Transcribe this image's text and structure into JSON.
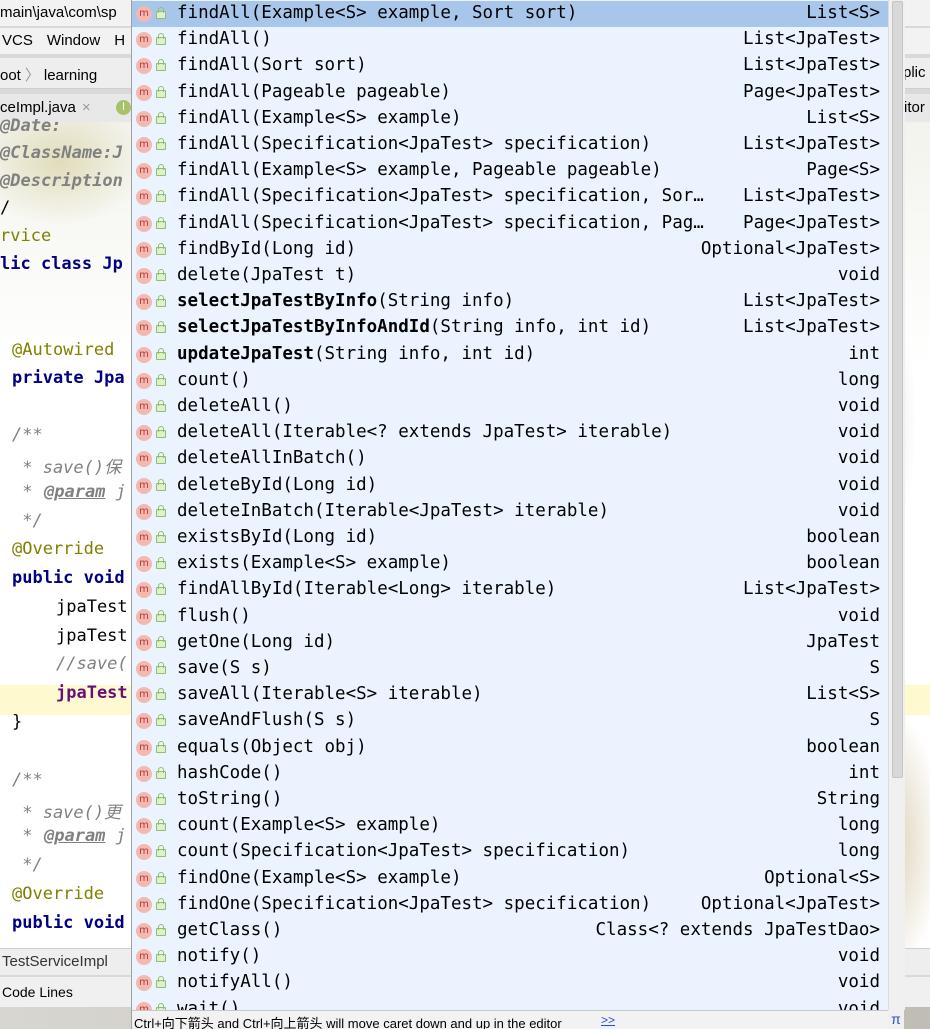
{
  "ide": {
    "path_fragment": "main\\java\\com\\sp",
    "menu": [
      "VCS",
      "Window",
      "H"
    ],
    "breadcrumbs": [
      "oot",
      "learning"
    ],
    "breadcrumb_right": "plic",
    "tab_label": "ceImpl.java",
    "tab_close": "×",
    "tab_badge": "I",
    "tab_right": "itor",
    "code_lines": [
      {
        "text": "@Date:",
        "style": "ann-doc"
      },
      {
        "text": "@ClassName:J",
        "style": "ann-doc"
      },
      {
        "text": "@Description",
        "style": "ann-doc"
      },
      {
        "text": "/",
        "style": "plain"
      },
      {
        "text": "rvice",
        "style": "ann"
      },
      {
        "text": "lic class Jp",
        "style": "kw"
      },
      {
        "text": "@Autowired",
        "style": "ann"
      },
      {
        "text": "private Jpa",
        "style": "kw"
      },
      {
        "text": "/**",
        "style": "cmt"
      },
      {
        "text": " * save()保",
        "style": "cmt"
      },
      {
        "text": "@param",
        "style": "doctag"
      },
      {
        "text": " */",
        "style": "cmt"
      },
      {
        "text": "@Override",
        "style": "ann"
      },
      {
        "text": "public void",
        "style": "kw"
      },
      {
        "text": "jpaTest",
        "style": "plain"
      },
      {
        "text": "jpaTest",
        "style": "plain"
      },
      {
        "text": "//save(",
        "style": "cmt"
      },
      {
        "text": "jpaTest",
        "style": "field"
      },
      {
        "text": "}",
        "style": "plain"
      },
      {
        "text": "/**",
        "style": "cmt"
      },
      {
        "text": " * save()更",
        "style": "cmt"
      },
      {
        "text": "@param",
        "style": "doctag"
      },
      {
        "text": " */",
        "style": "cmt"
      },
      {
        "text": "@Override",
        "style": "ann"
      },
      {
        "text": "public void",
        "style": "kw"
      }
    ],
    "doc_param_suffix": "j",
    "status_text": "TestServiceImpl",
    "bottom_text": "Code Lines"
  },
  "completion": {
    "items": [
      {
        "name": "findAll",
        "params": "(Example<S> example, Sort sort)",
        "type": "List<S>",
        "bold": false,
        "selected": true
      },
      {
        "name": "findAll",
        "params": "()",
        "type": "List<JpaTest>",
        "bold": false
      },
      {
        "name": "findAll",
        "params": "(Sort sort)",
        "type": "List<JpaTest>",
        "bold": false
      },
      {
        "name": "findAll",
        "params": "(Pageable pageable)",
        "type": "Page<JpaTest>",
        "bold": false
      },
      {
        "name": "findAll",
        "params": "(Example<S> example)",
        "type": "List<S>",
        "bold": false
      },
      {
        "name": "findAll",
        "params": "(Specification<JpaTest> specification)",
        "type": "List<JpaTest>",
        "bold": false
      },
      {
        "name": "findAll",
        "params": "(Example<S> example, Pageable pageable)",
        "type": "Page<S>",
        "bold": false
      },
      {
        "name": "findAll",
        "params": "(Specification<JpaTest> specification, Sor…",
        "type": "List<JpaTest>",
        "bold": false
      },
      {
        "name": "findAll",
        "params": "(Specification<JpaTest> specification, Pag…",
        "type": "Page<JpaTest>",
        "bold": false
      },
      {
        "name": "findById",
        "params": "(Long id)",
        "type": "Optional<JpaTest>",
        "bold": false
      },
      {
        "name": "delete",
        "params": "(JpaTest t)",
        "type": "void",
        "bold": false
      },
      {
        "name": "selectJpaTestByInfo",
        "params": "(String info)",
        "type": "List<JpaTest>",
        "bold": true
      },
      {
        "name": "selectJpaTestByInfoAndId",
        "params": "(String info, int id)",
        "type": "List<JpaTest>",
        "bold": true
      },
      {
        "name": "updateJpaTest",
        "params": "(String info, int id)",
        "type": "int",
        "bold": true
      },
      {
        "name": "count",
        "params": "()",
        "type": "long",
        "bold": false
      },
      {
        "name": "deleteAll",
        "params": "()",
        "type": "void",
        "bold": false
      },
      {
        "name": "deleteAll",
        "params": "(Iterable<? extends JpaTest> iterable)",
        "type": "void",
        "bold": false
      },
      {
        "name": "deleteAllInBatch",
        "params": "()",
        "type": "void",
        "bold": false
      },
      {
        "name": "deleteById",
        "params": "(Long id)",
        "type": "void",
        "bold": false
      },
      {
        "name": "deleteInBatch",
        "params": "(Iterable<JpaTest> iterable)",
        "type": "void",
        "bold": false
      },
      {
        "name": "existsById",
        "params": "(Long id)",
        "type": "boolean",
        "bold": false
      },
      {
        "name": "exists",
        "params": "(Example<S> example)",
        "type": "boolean",
        "bold": false
      },
      {
        "name": "findAllById",
        "params": "(Iterable<Long> iterable)",
        "type": "List<JpaTest>",
        "bold": false
      },
      {
        "name": "flush",
        "params": "()",
        "type": "void",
        "bold": false
      },
      {
        "name": "getOne",
        "params": "(Long id)",
        "type": "JpaTest",
        "bold": false
      },
      {
        "name": "save",
        "params": "(S s)",
        "type": "S",
        "bold": false
      },
      {
        "name": "saveAll",
        "params": "(Iterable<S> iterable)",
        "type": "List<S>",
        "bold": false
      },
      {
        "name": "saveAndFlush",
        "params": "(S s)",
        "type": "S",
        "bold": false
      },
      {
        "name": "equals",
        "params": "(Object obj)",
        "type": "boolean",
        "bold": false
      },
      {
        "name": "hashCode",
        "params": "()",
        "type": "int",
        "bold": false
      },
      {
        "name": "toString",
        "params": "()",
        "type": "String",
        "bold": false
      },
      {
        "name": "count",
        "params": "(Example<S> example)",
        "type": "long",
        "bold": false
      },
      {
        "name": "count",
        "params": "(Specification<JpaTest> specification)",
        "type": "long",
        "bold": false
      },
      {
        "name": "findOne",
        "params": "(Example<S> example)",
        "type": "Optional<S>",
        "bold": false
      },
      {
        "name": "findOne",
        "params": "(Specification<JpaTest> specification)",
        "type": "Optional<JpaTest>",
        "bold": false
      },
      {
        "name": "getClass",
        "params": "()",
        "type": "Class<? extends JpaTestDao>",
        "bold": false
      },
      {
        "name": "notify",
        "params": "()",
        "type": "void",
        "bold": false
      },
      {
        "name": "notifyAll",
        "params": "()",
        "type": "void",
        "bold": false
      },
      {
        "name": "wait",
        "params": "()",
        "type": "void",
        "bold": false
      }
    ],
    "method_icon_letter": "m",
    "hint": "Ctrl+向下箭头 and Ctrl+向上箭头 will move caret down and up in the editor",
    "hint_link": ">>",
    "corner_glyph": "π"
  }
}
